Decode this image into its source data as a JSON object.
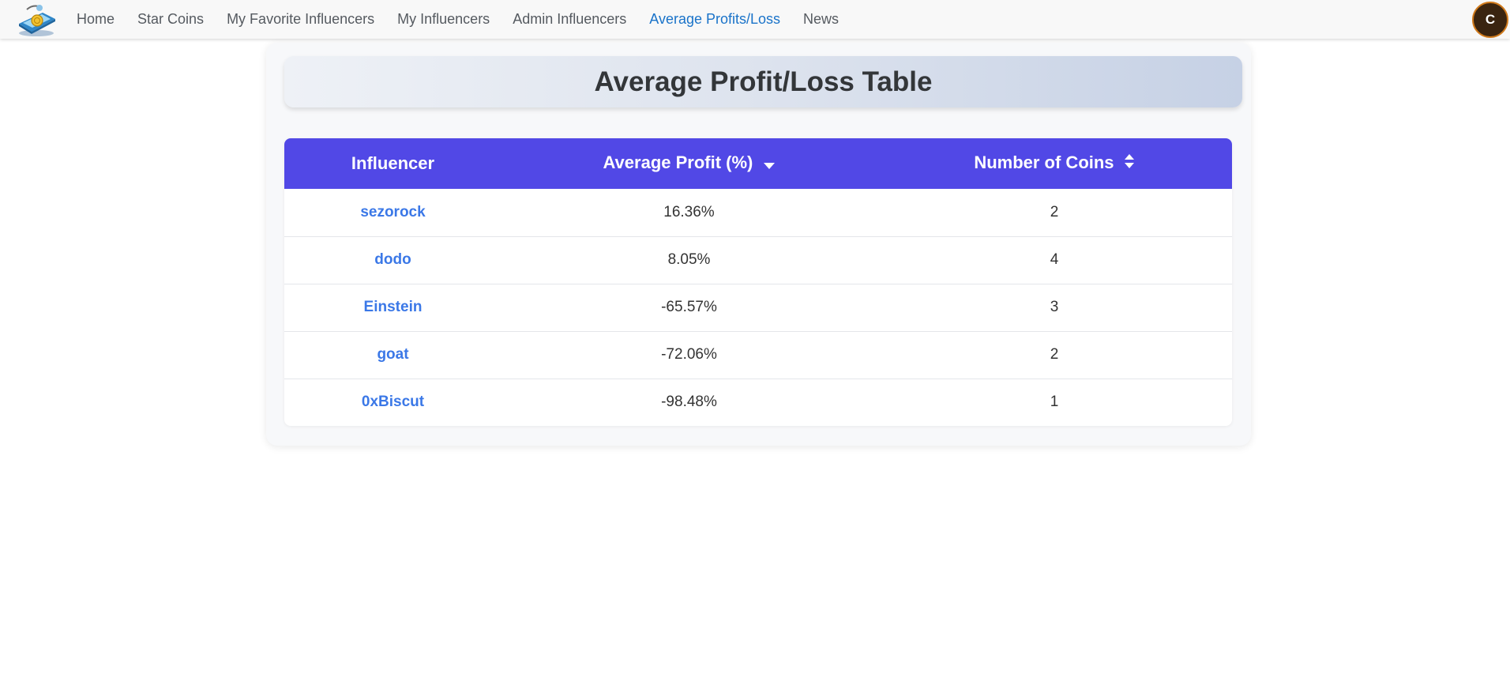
{
  "nav": {
    "links": [
      {
        "label": "Home",
        "active": false
      },
      {
        "label": "Star Coins",
        "active": false
      },
      {
        "label": "My Favorite Influencers",
        "active": false
      },
      {
        "label": "My Influencers",
        "active": false
      },
      {
        "label": "Admin Influencers",
        "active": false
      },
      {
        "label": "Average Profits/Loss",
        "active": true
      },
      {
        "label": "News",
        "active": false
      }
    ],
    "avatar_initial": "C"
  },
  "page": {
    "title": "Average Profit/Loss Table"
  },
  "table": {
    "headers": {
      "influencer": "Influencer",
      "avg_profit": "Average Profit (%)",
      "num_coins": "Number of Coins"
    },
    "rows": [
      {
        "influencer": "sezorock",
        "avg_profit": "16.36%",
        "num_coins": "2"
      },
      {
        "influencer": "dodo",
        "avg_profit": "8.05%",
        "num_coins": "4"
      },
      {
        "influencer": "Einstein",
        "avg_profit": "-65.57%",
        "num_coins": "3"
      },
      {
        "influencer": "goat",
        "avg_profit": "-72.06%",
        "num_coins": "2"
      },
      {
        "influencer": "0xBiscut",
        "avg_profit": "-98.48%",
        "num_coins": "1"
      }
    ]
  },
  "colors": {
    "accent": "#5148e6",
    "link": "#3b78e7",
    "nav_active": "#1a73c9"
  },
  "icons": {
    "logo": "app-logo",
    "avg_profit_sort": "caret-down-icon",
    "num_coins_sort": "sort-icon"
  }
}
